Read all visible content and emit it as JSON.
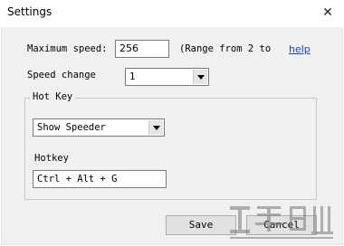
{
  "window": {
    "title": "Settings",
    "close_glyph": "✕"
  },
  "max_speed": {
    "label": "Maximum speed:",
    "value": "256",
    "range_note": "(Range from 2 to",
    "help_link": "help"
  },
  "speed_change": {
    "label": "Speed change",
    "value": "1"
  },
  "hotkey_group": {
    "legend": "Hot Key",
    "mode_value": "Show Speeder",
    "hotkey_label": "Hotkey",
    "hotkey_value": "Ctrl + Alt + G"
  },
  "buttons": {
    "save": "Save",
    "cancel": "Cancel"
  }
}
